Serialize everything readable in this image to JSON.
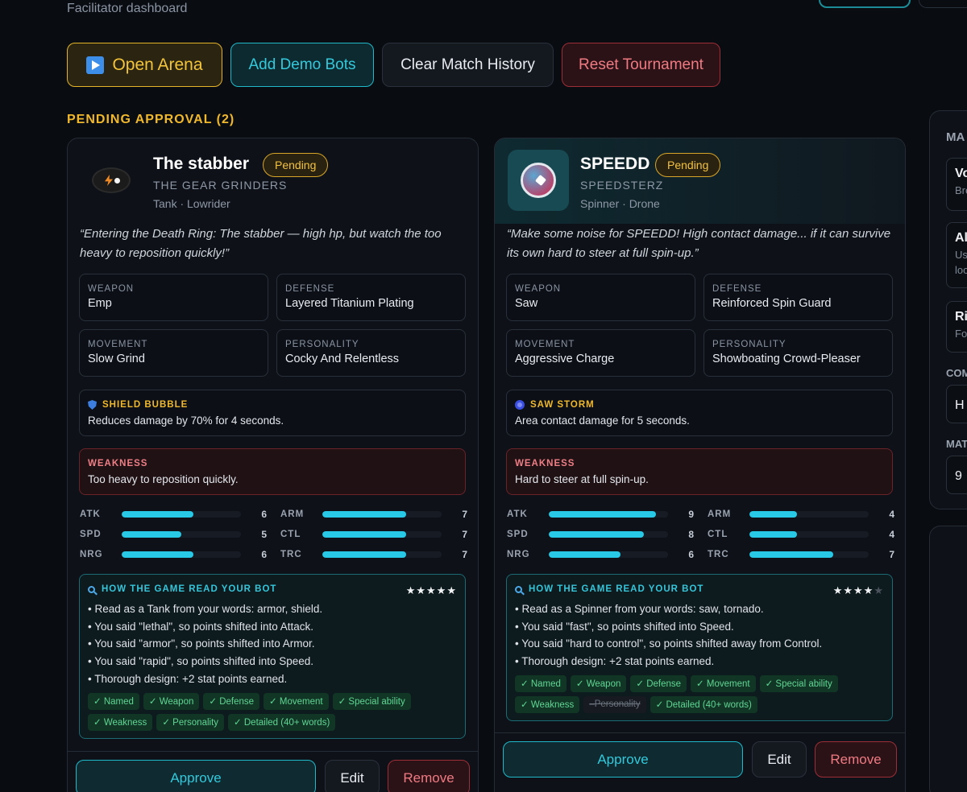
{
  "header": {
    "subtitle": "Facilitator dashboard"
  },
  "actions": {
    "open_arena": "Open Arena",
    "add_demo": "Add Demo Bots",
    "clear_history": "Clear Match History",
    "reset": "Reset Tournament"
  },
  "section": {
    "title": "PENDING APPROVAL (2)"
  },
  "bots": [
    {
      "name": "The stabber",
      "status": "Pending",
      "team": "THE GEAR GRINDERS",
      "class": "Tank · Lowrider",
      "quote": "“Entering the Death Ring: The stabber — high hp, but watch the too heavy to reposition quickly!”",
      "weapon_label": "WEAPON",
      "weapon": "Emp",
      "defense_label": "DEFENSE",
      "defense": "Layered Titanium Plating",
      "movement_label": "MOVEMENT",
      "movement": "Slow Grind",
      "personality_label": "PERSONALITY",
      "personality": "Cocky And Relentless",
      "special_title": "SHIELD BUBBLE",
      "special_icon": "shield-icon",
      "special_desc": "Reduces damage by 70% for 4 seconds.",
      "weakness_label": "WEAKNESS",
      "weakness": "Too heavy to reposition quickly.",
      "stats": [
        {
          "label": "ATK",
          "value": 6
        },
        {
          "label": "SPD",
          "value": 5
        },
        {
          "label": "NRG",
          "value": 6
        },
        {
          "label": "ARM",
          "value": 7
        },
        {
          "label": "CTL",
          "value": 7
        },
        {
          "label": "TRC",
          "value": 7
        }
      ],
      "read_title": "HOW THE GAME READ YOUR BOT",
      "rating": 5,
      "rating_max": 5,
      "read_lines": [
        "• Read as a Tank from your words: armor, shield.",
        "• You said \"lethal\", so points shifted into Attack.",
        "• You said \"armor\", so points shifted into Armor.",
        "• You said \"rapid\", so points shifted into Speed.",
        "• Thorough design: +2 stat points earned."
      ],
      "tags": [
        {
          "label": "✓ Named",
          "on": true
        },
        {
          "label": "✓ Weapon",
          "on": true
        },
        {
          "label": "✓ Defense",
          "on": true
        },
        {
          "label": "✓ Movement",
          "on": true
        },
        {
          "label": "✓ Special ability",
          "on": true
        },
        {
          "label": "✓ Weakness",
          "on": true
        },
        {
          "label": "✓ Personality",
          "on": true
        },
        {
          "label": "✓ Detailed (40+ words)",
          "on": true
        }
      ],
      "approve": "Approve",
      "edit": "Edit",
      "remove": "Remove"
    },
    {
      "name": "SPEEDD",
      "status": "Pending",
      "team": "SPEEDSTERZ",
      "class": "Spinner · Drone",
      "quote": "“Make some noise for SPEEDD! High contact damage... if it can survive its own hard to steer at full spin-up.”",
      "weapon_label": "WEAPON",
      "weapon": "Saw",
      "defense_label": "DEFENSE",
      "defense": "Reinforced Spin Guard",
      "movement_label": "MOVEMENT",
      "movement": "Aggressive Charge",
      "personality_label": "PERSONALITY",
      "personality": "Showboating Crowd-Pleaser",
      "special_title": "SAW STORM",
      "special_icon": "storm-icon",
      "special_desc": "Area contact damage for 5 seconds.",
      "weakness_label": "WEAKNESS",
      "weakness": "Hard to steer at full spin-up.",
      "stats": [
        {
          "label": "ATK",
          "value": 9
        },
        {
          "label": "SPD",
          "value": 8
        },
        {
          "label": "NRG",
          "value": 6
        },
        {
          "label": "ARM",
          "value": 4
        },
        {
          "label": "CTL",
          "value": 4
        },
        {
          "label": "TRC",
          "value": 7
        }
      ],
      "read_title": "HOW THE GAME READ YOUR BOT",
      "rating": 4,
      "rating_max": 5,
      "read_lines": [
        "• Read as a Spinner from your words: saw, tornado.",
        "• You said \"fast\", so points shifted into Speed.",
        "• You said \"hard to control\", so points shifted away from Control.",
        "• Thorough design: +2 stat points earned."
      ],
      "tags": [
        {
          "label": "✓ Named",
          "on": true
        },
        {
          "label": "✓ Weapon",
          "on": true
        },
        {
          "label": "✓ Defense",
          "on": true
        },
        {
          "label": "✓ Movement",
          "on": true
        },
        {
          "label": "✓ Special ability",
          "on": true
        },
        {
          "label": "✓ Weakness",
          "on": true
        },
        {
          "label": "–Personality",
          "on": false
        },
        {
          "label": "✓ Detailed (40+ words)",
          "on": true
        }
      ],
      "approve": "Approve",
      "edit": "Edit",
      "remove": "Remove"
    }
  ],
  "sidebar": {
    "heading1": "MA",
    "cards": [
      {
        "title": "Vo",
        "sub": "Bre"
      },
      {
        "title": "Al",
        "sub": "Us",
        "sub2": "loo"
      },
      {
        "title": "Ri",
        "sub": "Fo"
      }
    ],
    "heading2": "COM",
    "field1": "H",
    "heading3": "MAT",
    "field2": "9"
  },
  "colors": {
    "accent": "#27c9e6",
    "pending": "#f2c241",
    "danger": "#f07a82",
    "ok": "#5fd693"
  }
}
